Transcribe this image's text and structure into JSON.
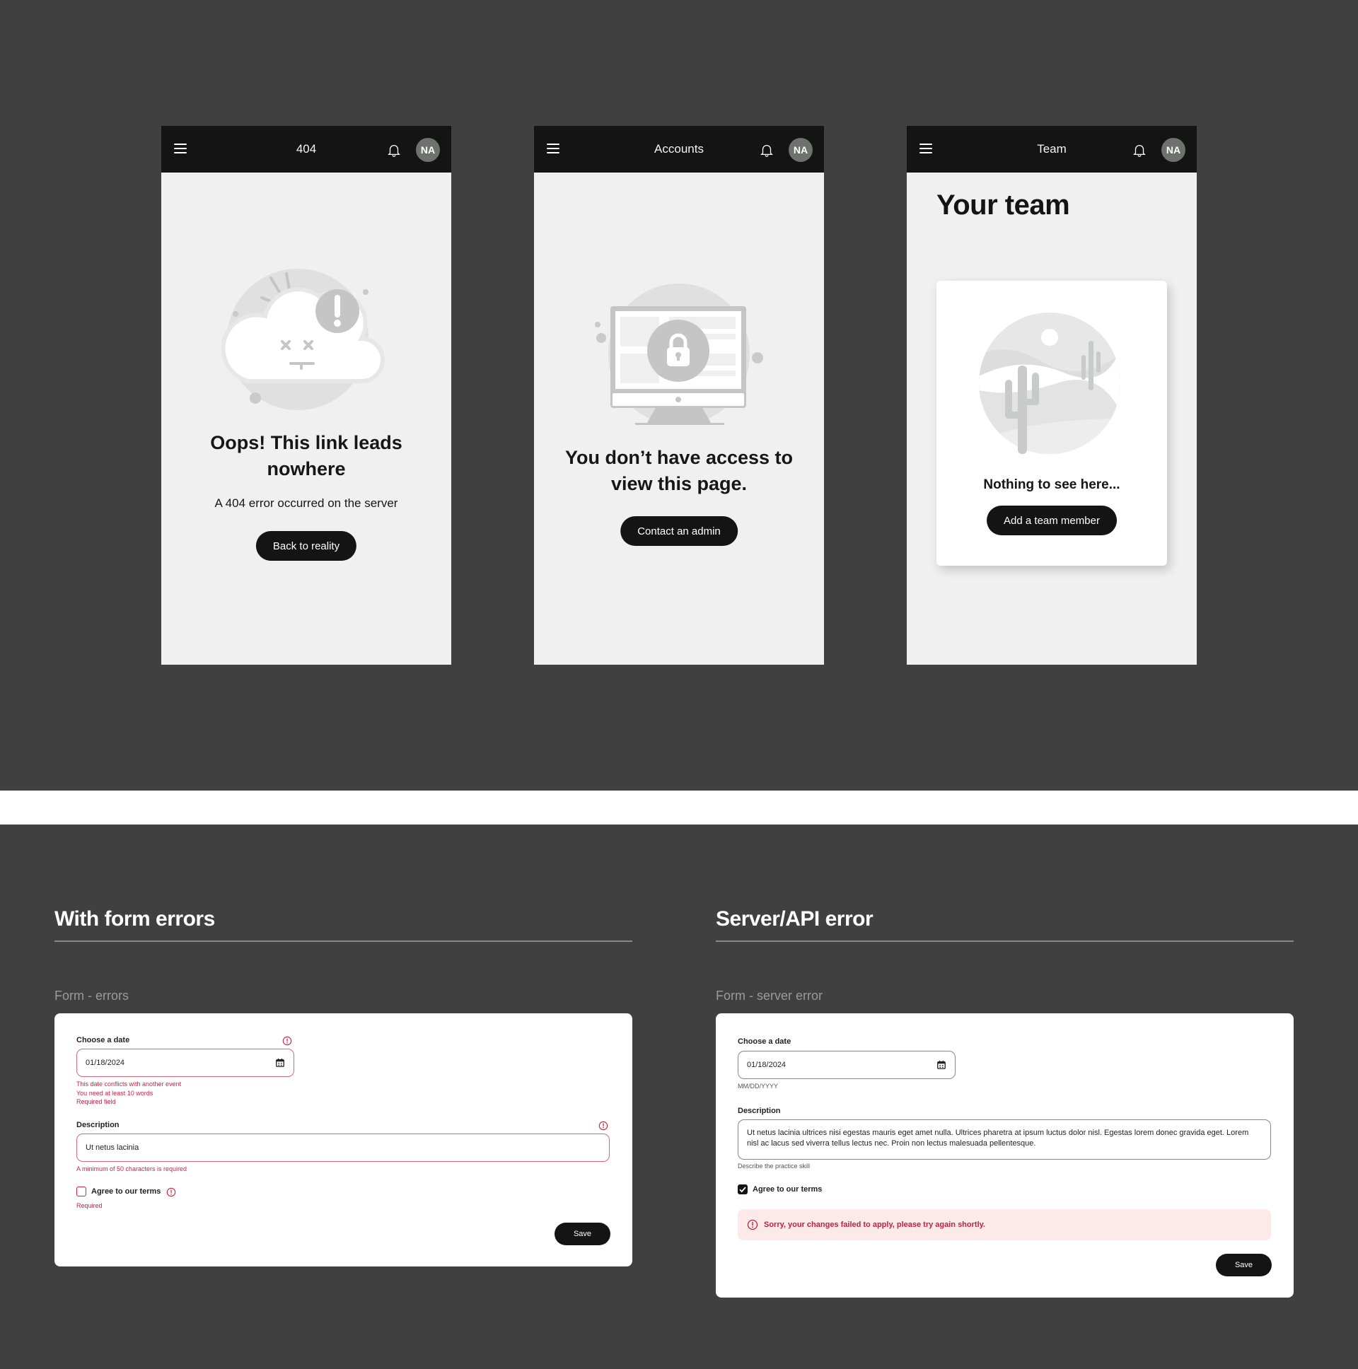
{
  "screens": [
    {
      "header_title": "404",
      "avatar_initials": "NA",
      "headline_line1": "Oops! This link leads",
      "headline_line2": "nowhere",
      "subtext": "A 404 error occurred on the server",
      "button_label": "Back to reality"
    },
    {
      "header_title": "Accounts",
      "avatar_initials": "NA",
      "headline_line1": "You don’t have access to",
      "headline_line2": "view this page.",
      "button_label": "Contact an admin"
    },
    {
      "header_title": "Team",
      "avatar_initials": "NA",
      "page_title": "Your team",
      "empty_text": "Nothing to see here...",
      "button_label": "Add a team member"
    }
  ],
  "form_errors": {
    "section_title": "With form errors",
    "caption": "Form  - errors",
    "date_label": "Choose a date",
    "date_value": "01/18/2024",
    "date_errors": [
      "This date conflicts with another event",
      "You need at least 10 words",
      "Required field"
    ],
    "description_label": "Description",
    "description_value": "Ut netus lacinia",
    "description_error": "A minimum of 50 characters is required",
    "terms_label": "Agree to our terms",
    "terms_checked": false,
    "terms_error": "Required",
    "save_label": "Save",
    "error_color": "#d0213f"
  },
  "server_error": {
    "section_title": "Server/API error",
    "caption": "Form - server error",
    "date_label": "Choose a date",
    "date_value": "01/18/2024",
    "date_hint": "MM/DD/YYYY",
    "description_label": "Description",
    "description_value": "Ut netus lacinia ultrices nisi egestas mauris eget amet nulla. Ultrices pharetra at ipsum luctus dolor nisl. Egestas lorem donec gravida eget. Lorem nisl ac lacus sed viverra tellus lectus nec. Proin non lectus malesuada pellentesque.",
    "description_hint": "Describe the practice skill",
    "terms_label": "Agree to our terms",
    "terms_checked": true,
    "banner_message": "Sorry, your changes failed to apply, please try again shortly.",
    "save_label": "Save",
    "banner_bg": "#fce9ea"
  }
}
